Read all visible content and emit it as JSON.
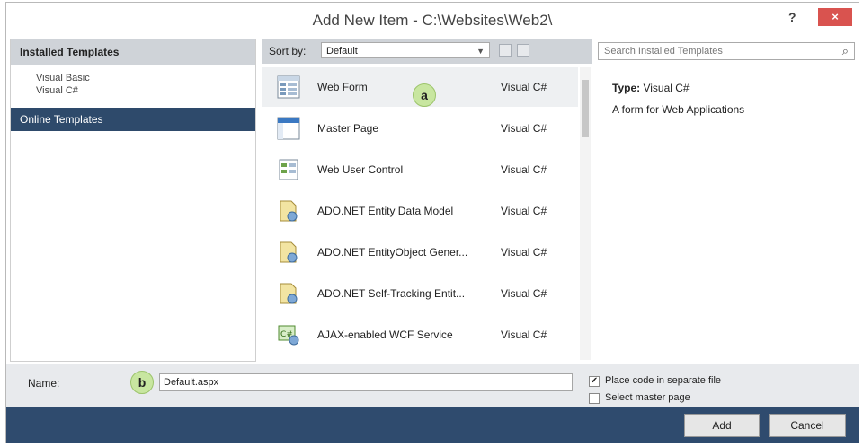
{
  "window": {
    "title": "Add New Item - C:\\Websites\\Web2\\",
    "help_label": "?",
    "close_label": "×"
  },
  "left_panel": {
    "header": "Installed Templates",
    "languages": [
      "Visual Basic",
      "Visual C#"
    ],
    "online": "Online Templates"
  },
  "toolbar": {
    "sort_label": "Sort by:",
    "sort_value": "Default"
  },
  "items": [
    {
      "name": "Web Form",
      "lang": "Visual C#"
    },
    {
      "name": "Master Page",
      "lang": "Visual C#"
    },
    {
      "name": "Web User Control",
      "lang": "Visual C#"
    },
    {
      "name": "ADO.NET Entity Data Model",
      "lang": "Visual C#"
    },
    {
      "name": "ADO.NET EntityObject Gener...",
      "lang": "Visual C#"
    },
    {
      "name": "ADO.NET Self-Tracking Entit...",
      "lang": "Visual C#"
    },
    {
      "name": "AJAX-enabled WCF Service",
      "lang": "Visual C#"
    }
  ],
  "badges": {
    "a": "a",
    "b": "b"
  },
  "search": {
    "placeholder": "Search Installed Templates"
  },
  "details": {
    "type_label": "Type:",
    "type_value": "Visual C#",
    "description": "A form for Web Applications"
  },
  "name_field": {
    "label": "Name:",
    "value": "Default.aspx"
  },
  "options": {
    "separate_file": {
      "label": "Place code in separate file",
      "checked": true
    },
    "master_page": {
      "label": "Select master page",
      "checked": false
    }
  },
  "buttons": {
    "add": "Add",
    "cancel": "Cancel"
  }
}
